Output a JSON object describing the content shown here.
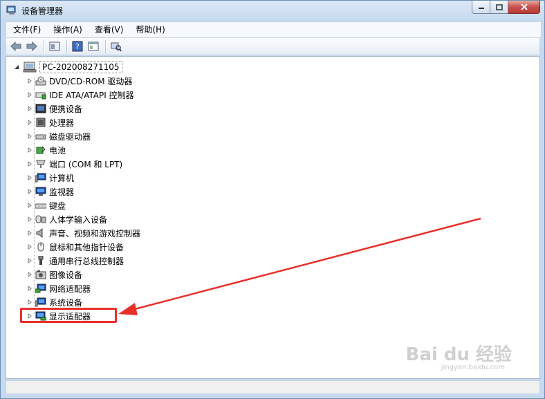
{
  "window": {
    "title": "设备管理器"
  },
  "menu": [
    "文件(F)",
    "操作(A)",
    "查看(V)",
    "帮助(H)"
  ],
  "toolbar_icons": [
    "back-icon",
    "forward-icon",
    "properties-icon",
    "help-icon",
    "view-icon",
    "scan-icon"
  ],
  "tree": {
    "root": "PC-202008271105",
    "nodes": [
      {
        "label": "DVD/CD-ROM 驱动器",
        "icon": "dvd-drive-icon"
      },
      {
        "label": "IDE ATA/ATAPI 控制器",
        "icon": "ide-controller-icon"
      },
      {
        "label": "便携设备",
        "icon": "portable-device-icon"
      },
      {
        "label": "处理器",
        "icon": "processor-icon"
      },
      {
        "label": "磁盘驱动器",
        "icon": "disk-drive-icon"
      },
      {
        "label": "电池",
        "icon": "battery-icon"
      },
      {
        "label": "端口 (COM 和 LPT)",
        "icon": "port-icon"
      },
      {
        "label": "计算机",
        "icon": "computer-icon"
      },
      {
        "label": "监视器",
        "icon": "monitor-icon"
      },
      {
        "label": "键盘",
        "icon": "keyboard-icon"
      },
      {
        "label": "人体学输入设备",
        "icon": "hid-icon"
      },
      {
        "label": "声音、视频和游戏控制器",
        "icon": "sound-icon"
      },
      {
        "label": "鼠标和其他指针设备",
        "icon": "mouse-icon"
      },
      {
        "label": "通用串行总线控制器",
        "icon": "usb-icon"
      },
      {
        "label": "图像设备",
        "icon": "imaging-icon"
      },
      {
        "label": "网络适配器",
        "icon": "network-adapter-icon"
      },
      {
        "label": "系统设备",
        "icon": "system-device-icon"
      },
      {
        "label": "显示适配器",
        "icon": "display-adapter-icon"
      }
    ]
  },
  "annotation": {
    "highlight_color": "#e8302a",
    "highlighted_node": "显示适配器"
  },
  "watermark": {
    "text": "Bai du 经验",
    "sub": "jingyan.baidu.com"
  }
}
